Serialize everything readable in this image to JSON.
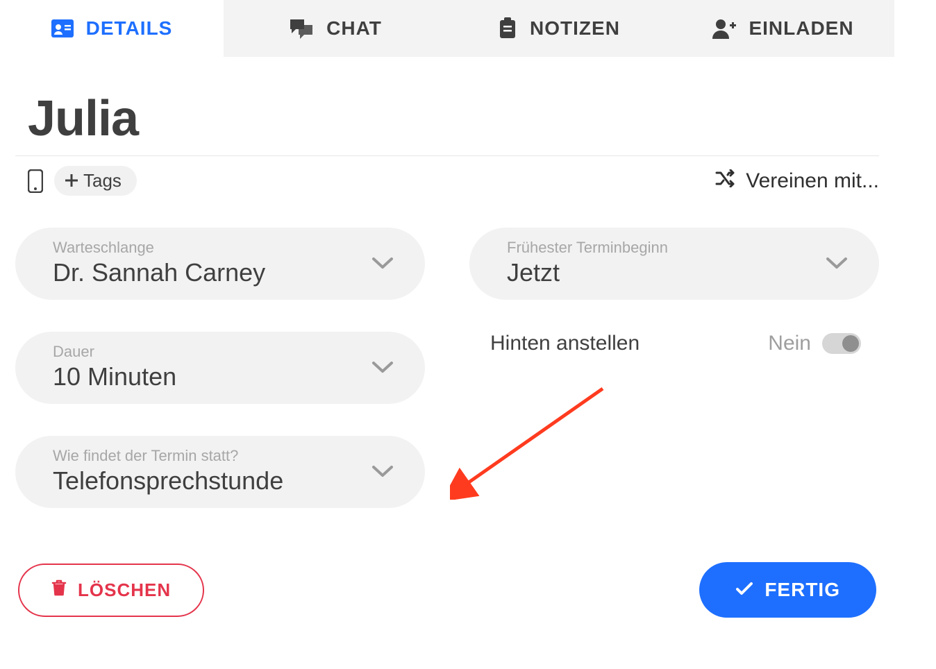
{
  "tabs": {
    "details": "DETAILS",
    "chat": "CHAT",
    "notes": "NOTIZEN",
    "invite": "EINLADEN"
  },
  "patient_name": "Julia",
  "tags_button": "Tags",
  "merge_label": "Vereinen mit...",
  "fields": {
    "queue": {
      "label": "Warteschlange",
      "value": "Dr. Sannah Carney"
    },
    "duration": {
      "label": "Dauer",
      "value": "10 Minuten"
    },
    "mode": {
      "label": "Wie findet der Termin statt?",
      "value": "Telefonsprechstunde"
    },
    "earliest": {
      "label": "Frühester Terminbeginn",
      "value": "Jetzt"
    }
  },
  "toggle_back": {
    "label": "Hinten anstellen",
    "value_label": "Nein",
    "on": false
  },
  "buttons": {
    "delete": "LÖSCHEN",
    "done": "FERTIG"
  },
  "icons": {
    "details": "id-card-icon",
    "chat": "chat-icon",
    "notes": "clipboard-icon",
    "invite": "user-plus-icon",
    "mobile": "mobile-icon",
    "plus": "plus-icon",
    "merge": "shuffle-icon",
    "chevron": "chevron-down-icon",
    "trash": "trash-icon",
    "check": "check-icon"
  },
  "colors": {
    "primary": "#1e6fff",
    "danger": "#e4344b",
    "field_bg": "#f2f2f2",
    "tab_inactive_bg": "#f3f3f3",
    "text": "#3f3f3f",
    "muted": "#9e9e9e",
    "annotation_arrow": "#ff3b1f"
  }
}
